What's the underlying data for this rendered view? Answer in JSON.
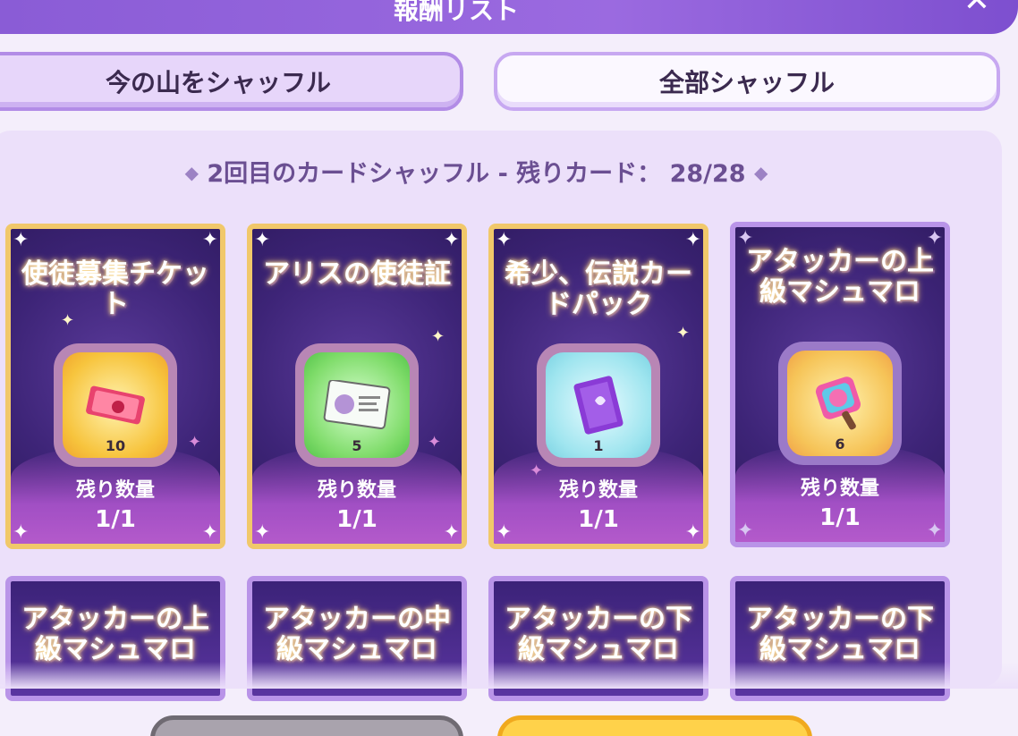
{
  "header": {
    "title": "報酬リスト",
    "close_icon": "close-icon"
  },
  "buttons": {
    "shuffle_pile": "今の山をシャッフル",
    "shuffle_all": "全部シャッフル"
  },
  "shuffle_info": {
    "text": "2回目のカードシャッフル - 残りカード： 28/28",
    "diamond": "◆"
  },
  "cards": [
    {
      "title": "使徒募集チケット",
      "count": "10",
      "remain_label": "残り数量",
      "remain": "1/1",
      "icon": "ticket-icon",
      "style": "gold"
    },
    {
      "title": "アリスの使徒証",
      "count": "5",
      "remain_label": "残り数量",
      "remain": "1/1",
      "icon": "id-card-icon",
      "style": "gold"
    },
    {
      "title": "希少、伝説カードパック",
      "count": "1",
      "remain_label": "残り数量",
      "remain": "1/1",
      "icon": "card-pack-icon",
      "style": "gold"
    },
    {
      "title": "アタッカーの上級マシュマロ",
      "count": "6",
      "remain_label": "残り数量",
      "remain": "1/1",
      "icon": "marshmallow-icon",
      "style": "violet"
    }
  ],
  "cards_row2": [
    {
      "title": "アタッカーの上級マシュマロ"
    },
    {
      "title": "アタッカーの中級マシュマロ"
    },
    {
      "title": "アタッカーの下級マシュマロ"
    },
    {
      "title": "アタッカーの下級マシュマロ"
    }
  ]
}
